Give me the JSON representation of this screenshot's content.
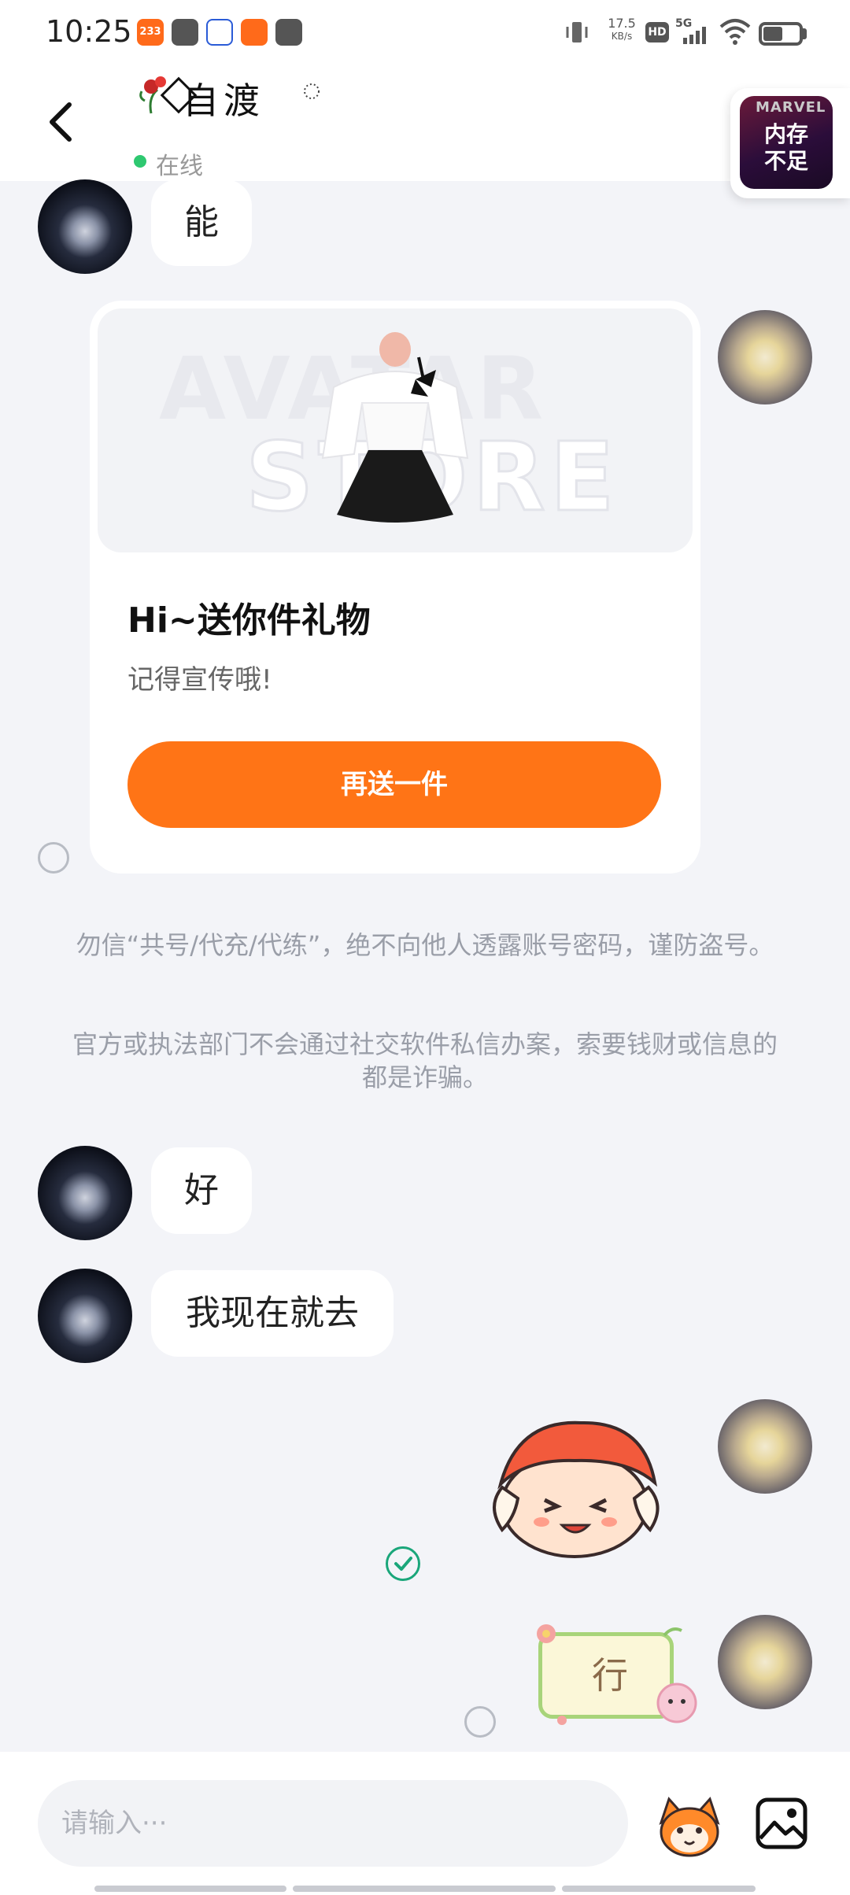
{
  "status_bar": {
    "time": "10:25",
    "app_badge_1": "233",
    "network_speed_value": "17.5",
    "network_speed_unit": "KB/s",
    "hd_badge": "HD",
    "signal_label": "5G",
    "battery_level": 0.5
  },
  "header": {
    "contact_name": "自渡",
    "online_status": "在线",
    "floating_game": {
      "brand": "MARVEL",
      "label": "内存\n不足"
    }
  },
  "messages": [
    {
      "sender": "other",
      "type": "text",
      "text": "能"
    },
    {
      "sender": "self",
      "type": "gift",
      "image_watermark_top": "AVATAR",
      "image_watermark_bottom": "STORE",
      "title": "Hi~送你件礼物",
      "subtitle": "记得宣传哦!",
      "button_label": "再送一件"
    },
    {
      "sender": "system",
      "type": "notice",
      "text": "勿信“共号/代充/代练”，绝不向他人透露账号密码，谨防盗号。"
    },
    {
      "sender": "system",
      "type": "notice",
      "text": "官方或执法部门不会通过社交软件私信办案，索要钱财或信息的都是诈骗。"
    },
    {
      "sender": "other",
      "type": "text",
      "text": "好"
    },
    {
      "sender": "other",
      "type": "text",
      "text": "我现在就去"
    },
    {
      "sender": "self",
      "type": "sticker",
      "sticker": "cartoon-face-sticker"
    },
    {
      "sender": "self",
      "type": "sticker",
      "text": "行"
    }
  ],
  "input": {
    "placeholder": "请输入···"
  },
  "icons": {
    "back": "chevron-left-icon",
    "emoji": "emoji-icon",
    "image": "image-icon",
    "read": "check-circle-icon"
  },
  "colors": {
    "accent": "#ff7416",
    "online": "#2ec870",
    "read_check": "#1aa67a",
    "background": "#f3f4f8"
  }
}
